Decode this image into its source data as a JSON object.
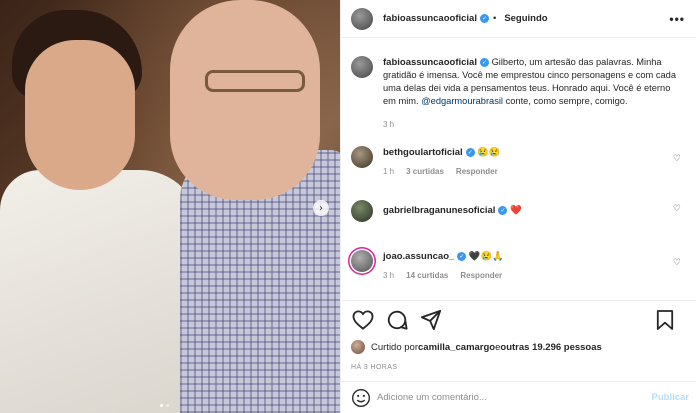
{
  "post": {
    "username": "fabioassuncaooficial",
    "follow_status": "Seguindo",
    "more": "•••",
    "caption_username": "fabioassuncaooficial",
    "caption_text_1": " Gilberto, um artesão das palavras. Minha gratidão é imensa. Você me emprestou cinco personagens e com cada uma delas dei vida a pensamentos teus. Honrado aqui. Você é eterno em mim. ",
    "caption_mention": "@edgarmourabrasil",
    "caption_text_2": " conte, como sempre, comigo.",
    "caption_time": "3 h"
  },
  "comments": [
    {
      "username": "bethgoulartoficial",
      "text": " 😢😢",
      "time": "1 h",
      "likes": "3 curtidas",
      "reply": "Responder"
    },
    {
      "username": "gabrielbraganunesoficial",
      "text": " ❤️",
      "time": "",
      "likes": "",
      "reply": ""
    },
    {
      "username": "joao.assuncao_",
      "text": " 🖤😢🙏",
      "time": "3 h",
      "likes": "14 curtidas",
      "reply": "Responder"
    }
  ],
  "likes": {
    "prefix": "Curtido por ",
    "user": "camilla_camargo",
    "middle": " e ",
    "others": "outras 19.296 pessoas"
  },
  "time_ago": "HÁ 3 HORAS",
  "comment_box": {
    "placeholder": "Adicione um comentário...",
    "publish": "Publicar"
  }
}
